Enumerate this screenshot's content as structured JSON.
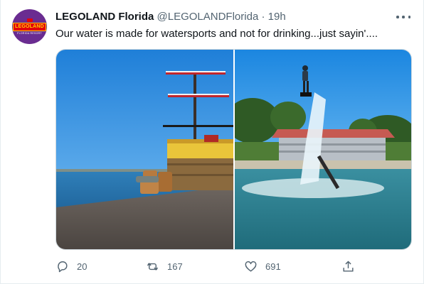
{
  "tweet": {
    "display_name": "LEGOLAND Florida",
    "handle": "@LEGOLANDFlorida",
    "separator": "·",
    "time": "19h",
    "text": "Our water is made for watersports and not for drinking...just sayin'....",
    "avatar": {
      "logo_text": "LEGOLAND",
      "logo_sub": "FLORIDA RESORT",
      "bg_color": "#6a2c91"
    },
    "media": [
      {
        "name": "pirate-ship-pier-photo"
      },
      {
        "name": "flyboard-watersports-photo"
      }
    ]
  },
  "actions": {
    "reply": {
      "icon": "reply-icon",
      "count": "20"
    },
    "retweet": {
      "icon": "retweet-icon",
      "count": "167"
    },
    "like": {
      "icon": "heart-icon",
      "count": "691"
    },
    "share": {
      "icon": "share-icon"
    }
  },
  "colors": {
    "text_primary": "#0f1419",
    "text_secondary": "#536471",
    "border": "#cfd9de"
  }
}
